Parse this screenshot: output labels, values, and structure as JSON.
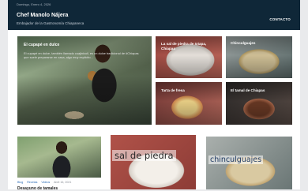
{
  "header": {
    "date": "Domingo, Enero 4, 2026",
    "site_title": "Chef Manolo Nájera",
    "tagline": "Embajador de la Gastronomía Chiapaneca",
    "nav": {
      "contact": "CONTACTO"
    }
  },
  "featured": {
    "hero": {
      "title": "El cupapé en dulce",
      "excerpt": "El cupapé en dulce, también llamado cuajinicuil, es un dulce tradicional de #Chiapas que suele prepararse en casa, algo muy explicito..."
    },
    "cards": [
      {
        "title": "La sal de piedra de Ixtapa, Chiapas"
      },
      {
        "title": "Chinculguajes"
      },
      {
        "title": "Tarta de fresa"
      },
      {
        "title": "El tamal de Chiapas"
      }
    ]
  },
  "posts": {
    "thumb2_text": "sal de piedra",
    "thumb3_text": "chinculguajes",
    "first": {
      "categories": [
        "Blog",
        "Recetas",
        "Videos"
      ],
      "date": "Abril 16, 2021",
      "title": "Desayuno de tamales"
    }
  }
}
